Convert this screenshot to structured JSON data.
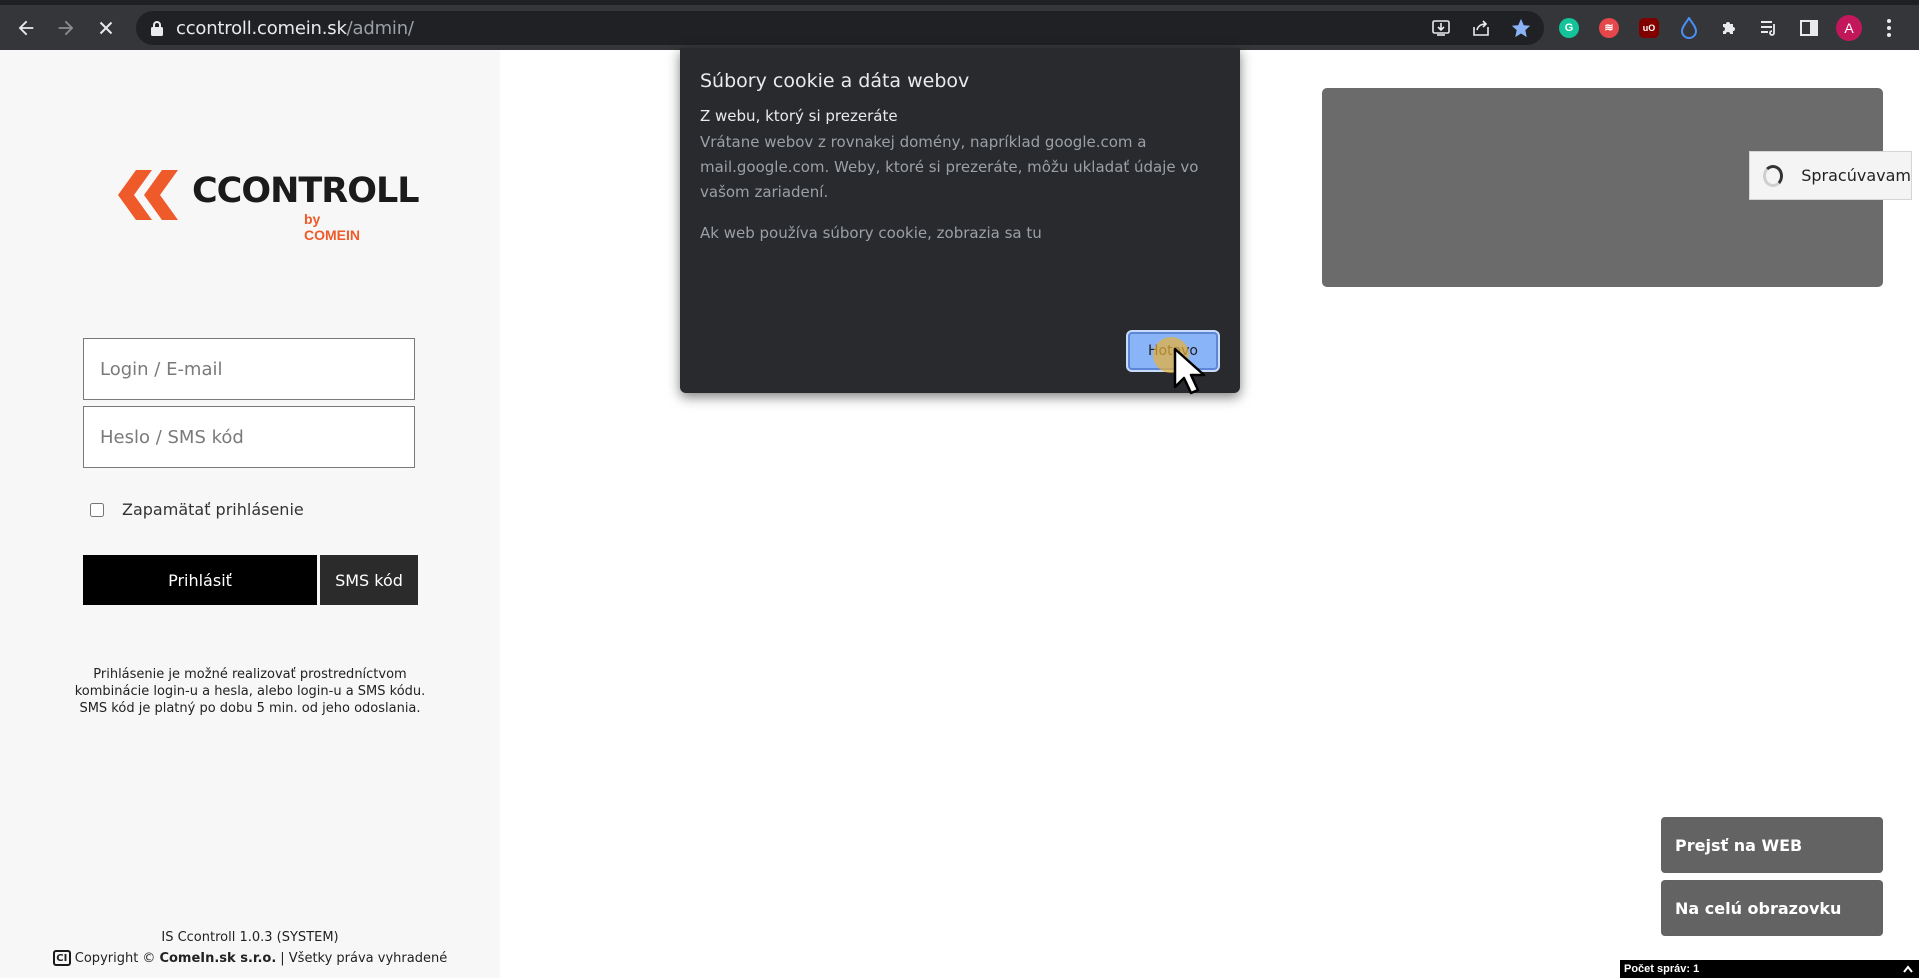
{
  "browser": {
    "url_host": "ccontroll.comein.sk",
    "url_path": "/admin/",
    "profile_initial": "A",
    "extensions": [
      {
        "name": "grammarly-icon",
        "color": "#15c39a",
        "glyph": "G"
      },
      {
        "name": "readwise-icon",
        "color": "#e5474b",
        "glyph": "≋"
      },
      {
        "name": "ublock-icon",
        "color": "#800000",
        "glyph": "uO"
      },
      {
        "name": "droplet-icon",
        "color": "#4a8ff7",
        "glyph": ""
      }
    ]
  },
  "login": {
    "logo_text": "CCONTROLL",
    "logo_sub": "by COMEIN",
    "login_placeholder": "Login / E-mail",
    "password_placeholder": "Heslo / SMS kód",
    "remember_label": "Zapamätať prihlásenie",
    "login_button": "Prihlásiť",
    "sms_button": "SMS kód",
    "help_text": "Prihlásenie je možné realizovať prostredníctvom kombinácie login-u a hesla, alebo login-u a SMS kódu. SMS kód je platný po dobu 5 min. od jeho odoslania."
  },
  "footer": {
    "version": "IS Ccontroll 1.0.3 (SYSTEM)",
    "copyright_prefix": "Copyright ©",
    "company": "ComeIn.sk s.r.o.",
    "rights": "| Všetky práva vyhradené",
    "badge": "CI"
  },
  "right": {
    "processing": "Spracúvavam",
    "go_web": "Prejsť na WEB",
    "fullscreen": "Na celú obrazovku",
    "message_count": "Počet správ: 1"
  },
  "popup": {
    "title": "Súbory cookie a dáta webov",
    "subtitle": "Z webu, ktorý si prezeráte",
    "description": "Vrátane webov z rovnakej domény, napríklad google.com a mail.google.com. Weby, ktoré si prezeráte, môžu ukladať údaje vo vašom zariadení.",
    "note": "Ak web používa súbory cookie, zobrazia sa tu",
    "done": "Hotovo"
  }
}
